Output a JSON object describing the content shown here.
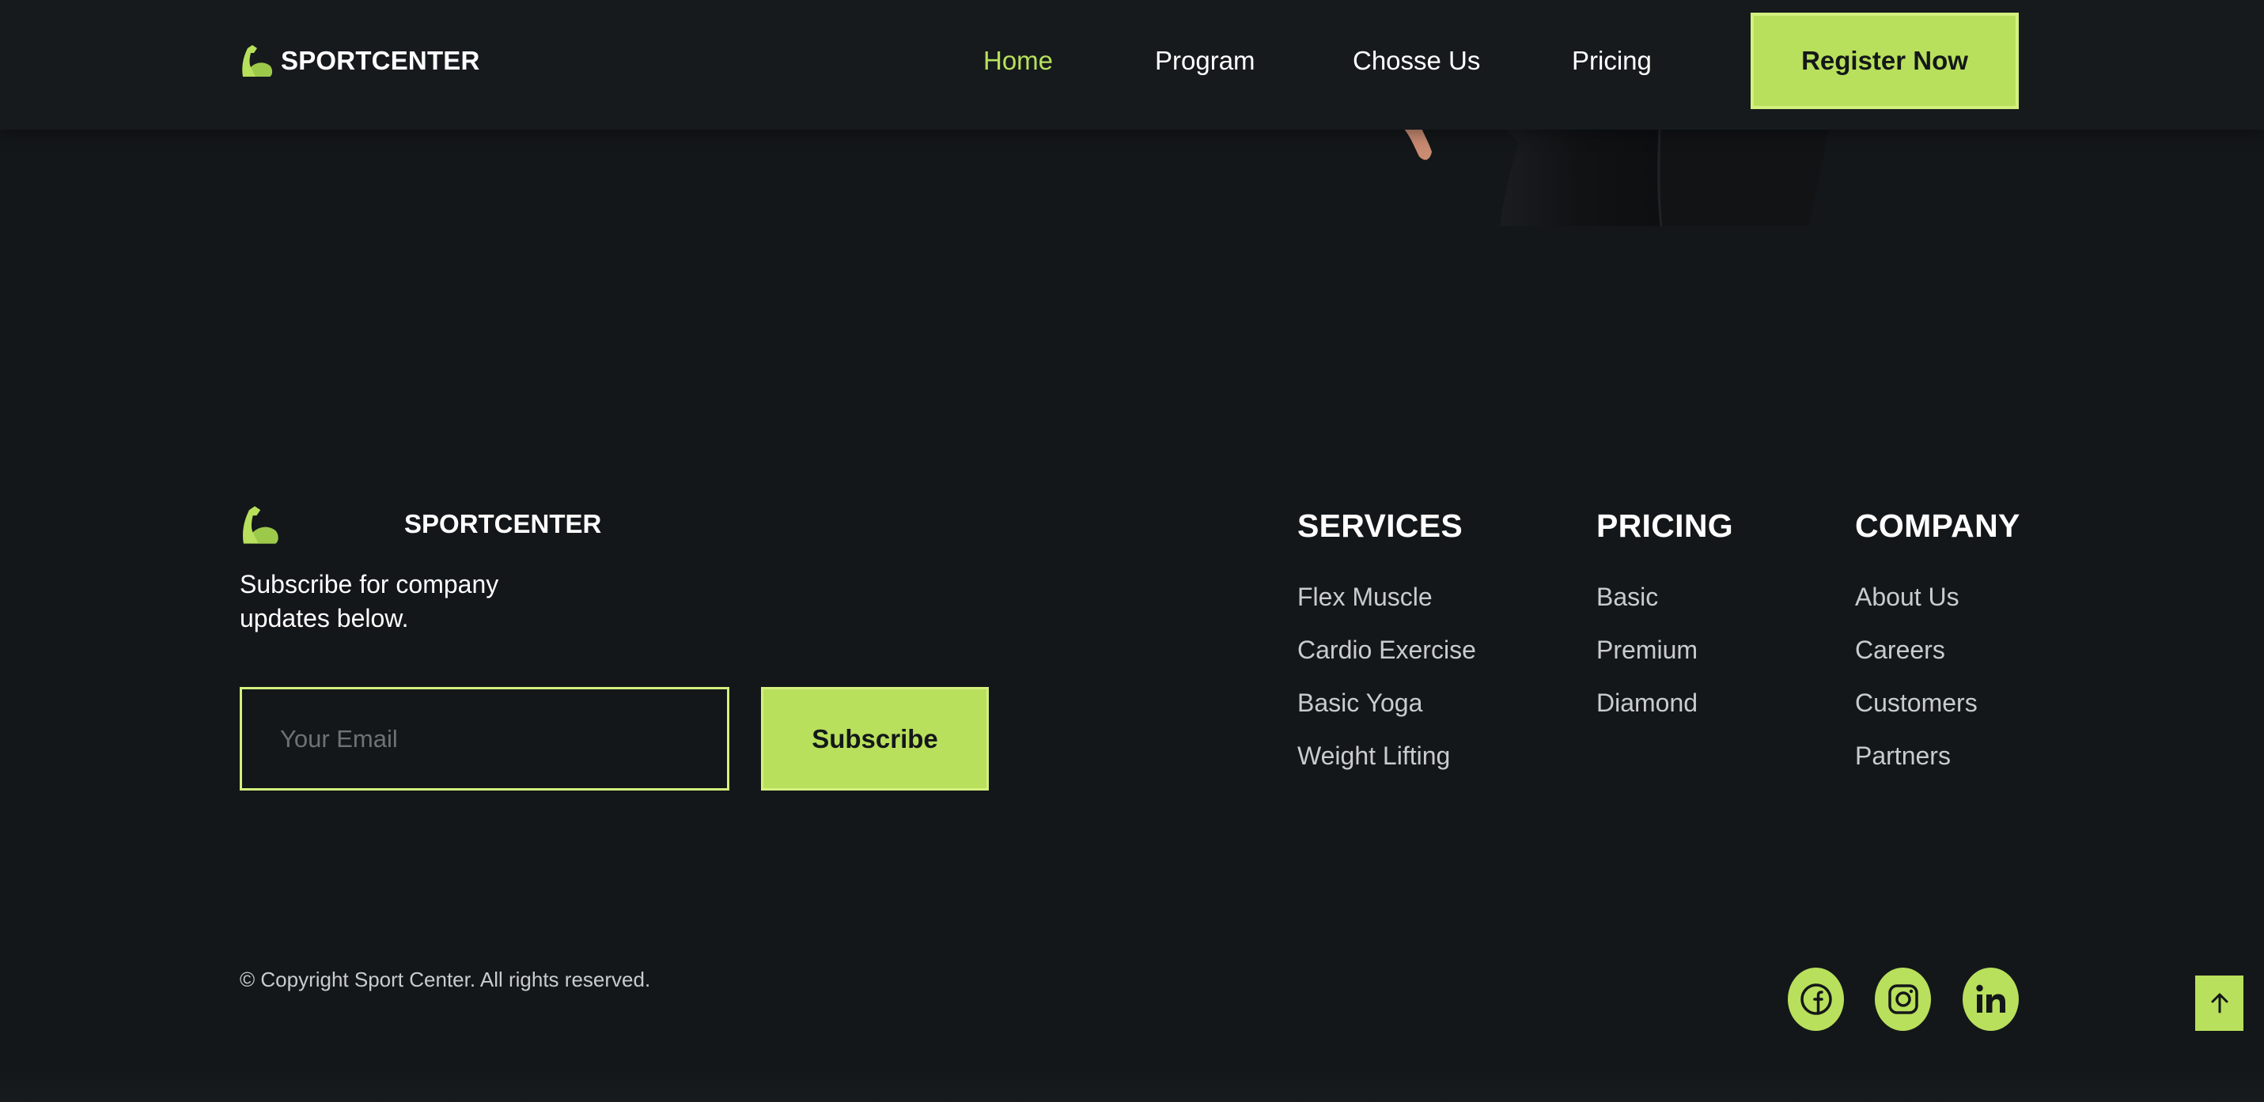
{
  "colors": {
    "accent": "#b8e05c",
    "background": "#141719",
    "header": "#161a1c",
    "muted_text": "#c9cccd"
  },
  "header": {
    "brand": {
      "icon": "flexed-arm-icon",
      "name": "SPORTCENTER"
    },
    "nav": [
      {
        "label": "Home",
        "active": true
      },
      {
        "label": "Program",
        "active": false
      },
      {
        "label": "Chosse Us",
        "active": false
      },
      {
        "label": "Pricing",
        "active": false
      }
    ],
    "register_label": "Register Now"
  },
  "footer": {
    "brand": {
      "icon": "flexed-arm-icon",
      "name": "SPORTCENTER"
    },
    "subscribe_text": "Subscribe for company updates below.",
    "email": {
      "placeholder": "Your Email",
      "value": ""
    },
    "subscribe_label": "Subscribe",
    "columns": [
      {
        "title": "SERVICES",
        "items": [
          "Flex Muscle",
          "Cardio Exercise",
          "Basic Yoga",
          "Weight Lifting"
        ]
      },
      {
        "title": "PRICING",
        "items": [
          "Basic",
          "Premium",
          "Diamond"
        ]
      },
      {
        "title": "COMPANY",
        "items": [
          "About Us",
          "Careers",
          "Customers",
          "Partners"
        ]
      }
    ],
    "copyright": "© Copyright Sport Center. All rights reserved.",
    "social": [
      {
        "icon": "facebook-icon"
      },
      {
        "icon": "instagram-icon"
      },
      {
        "icon": "linkedin-icon"
      }
    ],
    "back_to_top_icon": "arrow-up-icon"
  }
}
